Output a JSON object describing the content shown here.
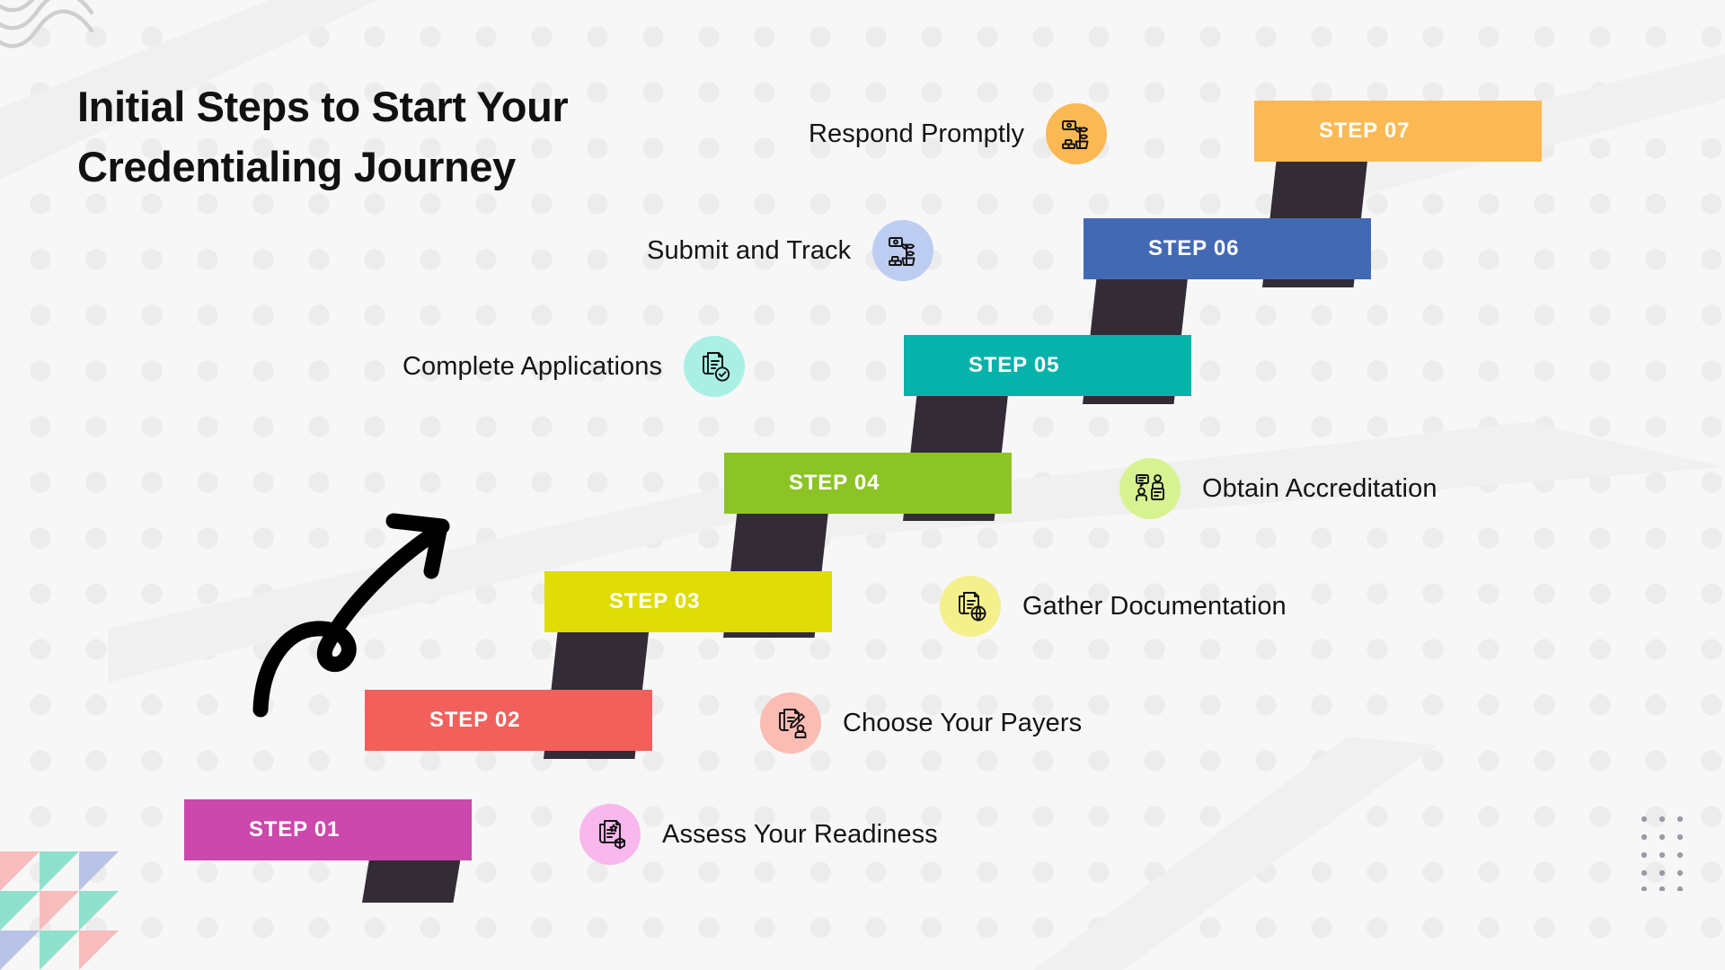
{
  "page": {
    "title": "Initial Steps to Start Your Credentialing Journey",
    "background_color": "#f7f7f7"
  },
  "colors": {
    "riser": "#332b35",
    "step_text": "#ffffff",
    "label_text": "#141414",
    "title_text": "#111111"
  },
  "staircase": {
    "steps": [
      {
        "label": "STEP 01",
        "color": "#cc48ac"
      },
      {
        "label": "STEP 02",
        "color": "#f2605c"
      },
      {
        "label": "STEP 03",
        "color": "#dfdc06"
      },
      {
        "label": "STEP 04",
        "color": "#8cc426"
      },
      {
        "label": "STEP 05",
        "color": "#06b2aa"
      },
      {
        "label": "STEP 06",
        "color": "#4469b4"
      },
      {
        "label": "STEP 07",
        "color": "#fbb954"
      }
    ]
  },
  "items": [
    {
      "label": "Assess Your Readiness",
      "icon": "document-star-cube-icon",
      "circle_color": "#f9b8ed",
      "side": "right"
    },
    {
      "label": "Choose Your Payers",
      "icon": "document-pen-person-icon",
      "circle_color": "#fbbcb4",
      "side": "right"
    },
    {
      "label": "Gather Documentation",
      "icon": "document-globe-icon",
      "circle_color": "#f4f08c",
      "side": "right"
    },
    {
      "label": "Obtain Accreditation",
      "icon": "people-network-icon",
      "circle_color": "#d7f291",
      "side": "right"
    },
    {
      "label": "Complete Applications",
      "icon": "document-check-icon",
      "circle_color": "#a9efe4",
      "side": "left"
    },
    {
      "label": "Submit and Track",
      "icon": "plant-growth-money-icon",
      "circle_color": "#bdcdf2",
      "side": "left"
    },
    {
      "label": "Respond Promptly",
      "icon": "plant-growth-money-icon",
      "circle_color": "#fbb954",
      "side": "left"
    }
  ],
  "decorations": {
    "corner_waves": "wave-lines-decoration",
    "corner_triangles": "triangle-grid-decoration",
    "dot_grid": "dot-grid-decoration",
    "hand_arrow": "curved-upward-arrow-icon",
    "triangle_colors": [
      "#f7bcbc",
      "#8fe0cd",
      "#b9c3e8"
    ]
  }
}
